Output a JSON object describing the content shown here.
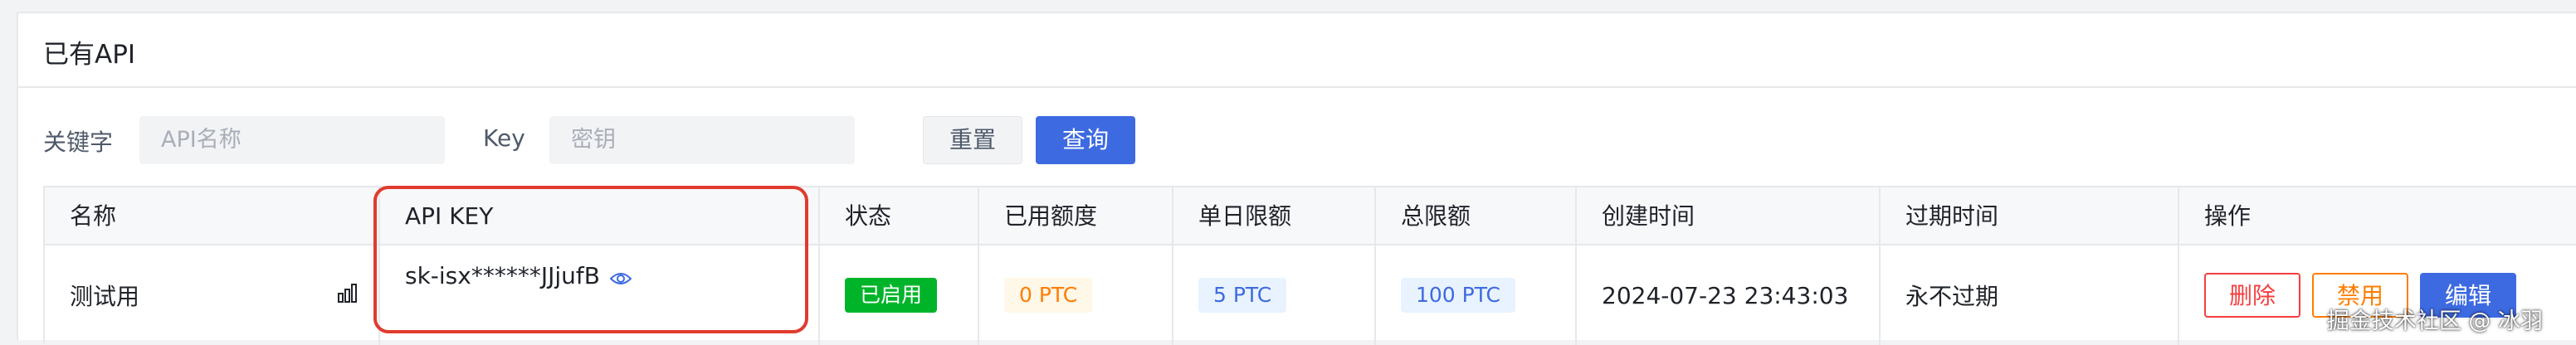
{
  "card": {
    "title": "已有API"
  },
  "filters": {
    "keyword_label": "关键字",
    "keyword_placeholder": "API名称",
    "key_label": "Key",
    "key_placeholder": "密钥",
    "reset_label": "重置",
    "query_label": "查询"
  },
  "table": {
    "columns": [
      "名称",
      "API KEY",
      "状态",
      "已用额度",
      "单日限额",
      "总限额",
      "创建时间",
      "过期时间",
      "操作"
    ],
    "rows": [
      {
        "name": "测试用",
        "api_key": "sk-isx******JJjufB",
        "status": "已启用",
        "used": "0 PTC",
        "daily_limit": "5 PTC",
        "total_limit": "100 PTC",
        "created_at": "2024-07-23 23:43:03",
        "expires": "永不过期",
        "actions": {
          "delete": "删除",
          "disable": "禁用",
          "edit": "编辑"
        }
      }
    ]
  },
  "colors": {
    "primary": "#3e6ae1",
    "success": "#00b42a",
    "danger": "#f53f3f",
    "warning": "#ff7d00",
    "highlight": "#e03b2e"
  },
  "watermark": "掘金技术社区 @ 冰羽"
}
